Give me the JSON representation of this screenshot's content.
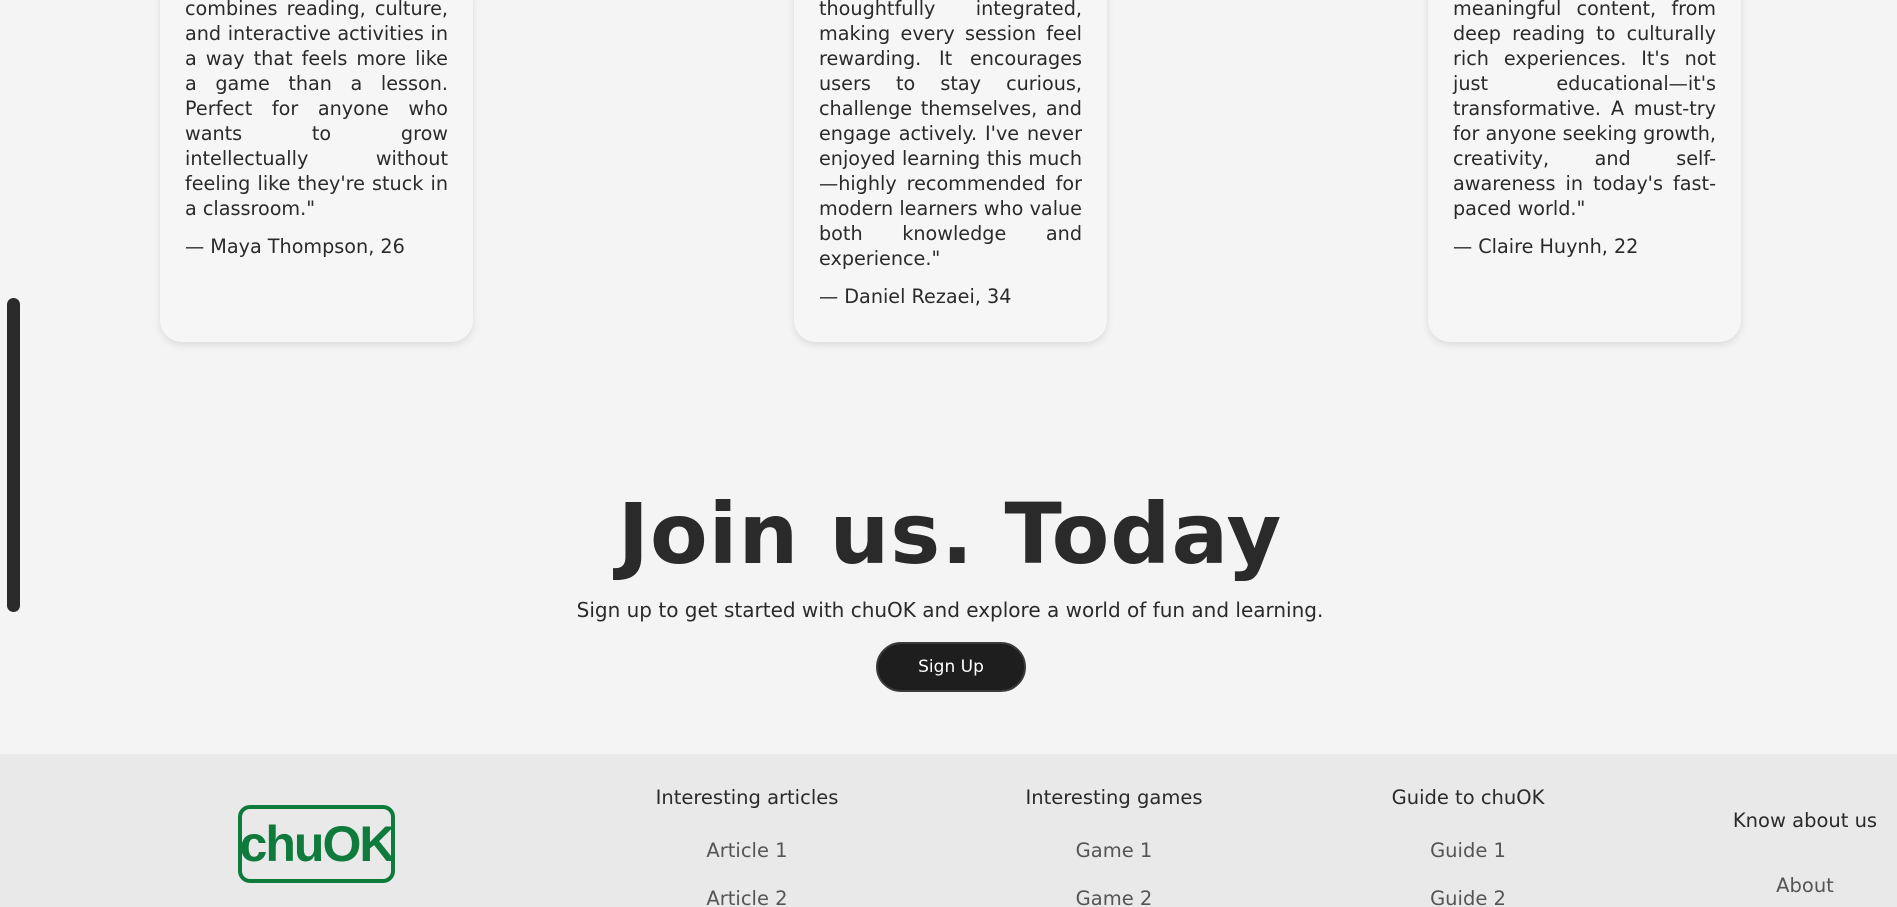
{
  "testimonials": [
    {
      "quote": "combines reading, culture, and interactive activities in a way that feels more like a game than a lesson. Perfect for anyone who wants to grow intellectually without feeling like they're stuck in a classroom.\"",
      "author": "— Maya Thompson, 26"
    },
    {
      "quote": "thoughtfully integrated, making every session feel rewarding. It encourages users to stay curious, challenge themselves, and engage actively. I've never enjoyed learning this much—highly recommended for modern learners who value both knowledge and experience.\"",
      "author": "— Daniel Rezaei, 34"
    },
    {
      "quote": "meaningful content, from deep reading to culturally rich experiences. It's not just educational—it's transformative. A must-try for anyone seeking growth, creativity, and self-awareness in today's fast-paced world.\"",
      "author": "— Claire Huynh, 22"
    }
  ],
  "cta": {
    "title": "Join us. Today",
    "subtitle": "Sign up to get started with chuOK and explore a world of fun and learning.",
    "button": "Sign Up"
  },
  "footer": {
    "logo_text": "chuOK",
    "brand_color": "#0e7a3c",
    "columns": [
      {
        "heading": "Interesting articles",
        "links": [
          "Article 1",
          "Article 2"
        ]
      },
      {
        "heading": "Interesting games",
        "links": [
          "Game 1",
          "Game 2"
        ]
      },
      {
        "heading": "Guide to chuOK",
        "links": [
          "Guide 1",
          "Guide 2"
        ]
      },
      {
        "heading": "Know about us",
        "links": [
          "About"
        ]
      }
    ]
  }
}
